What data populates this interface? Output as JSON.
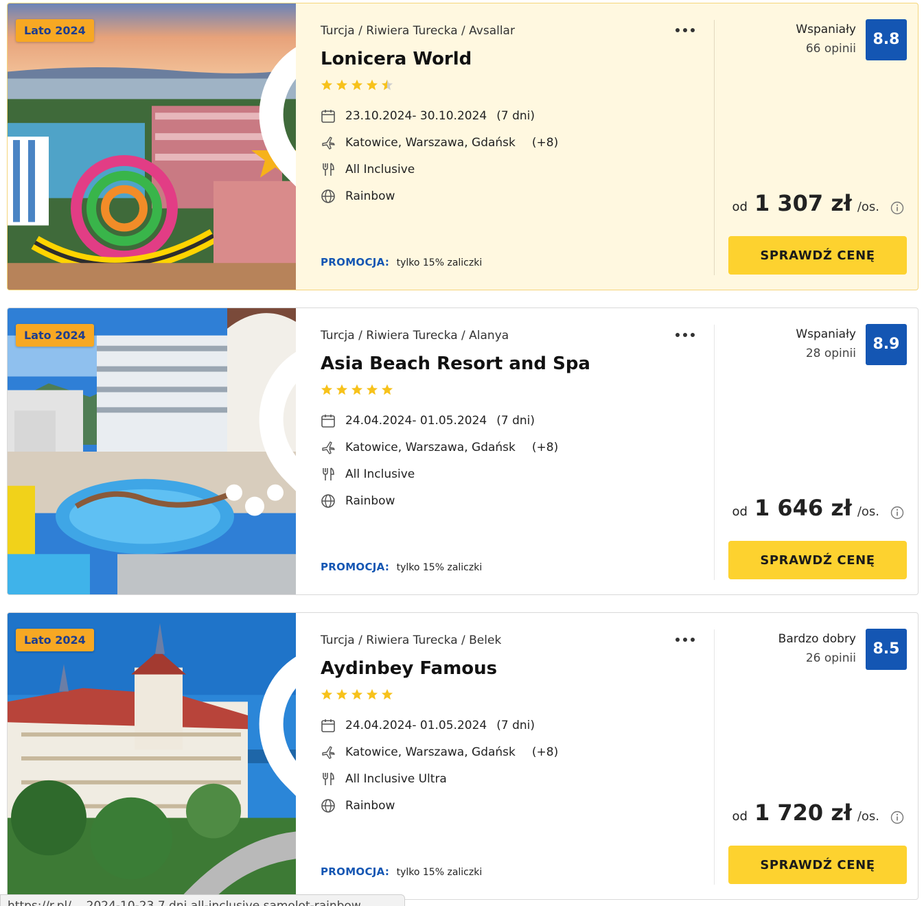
{
  "colors": {
    "badge_bg": "#f7a823",
    "badge_text": "#1d3d8f",
    "score_bg": "#1456b3",
    "promo_label": "#1456b3",
    "button_bg": "#fdd22f",
    "highlight_bg": "#fff8e0",
    "star": "#f7c21b"
  },
  "icons": {
    "favorite": "heart-outline-icon",
    "more": "more-dots-icon",
    "date": "calendar-icon",
    "departure": "plane-icon",
    "board": "cutlery-icon",
    "operator": "globe-icon",
    "price_info": "info-circle-icon",
    "rating_star": "star-icon"
  },
  "offers": [
    {
      "badge": "Lato 2024",
      "breadcrumb": "Turcja / Riwiera Turecka / Avsallar",
      "name": "Lonicera World",
      "stars": 4.5,
      "dates": "23.10.2024- 30.10.2024",
      "duration": "(7 dni)",
      "departure": "Katowice, Warszawa, Gdańsk",
      "departure_more": "(+8)",
      "board": "All Inclusive",
      "operator": "Rainbow",
      "promo_label": "PROMOCJA:",
      "promo_text": "tylko 15% zaliczki",
      "rating_label": "Wspaniały",
      "reviews": "66 opinii",
      "score": "8.8",
      "price_prefix": "od",
      "price": "1 307 zł",
      "price_unit": "/os.",
      "cta": "SPRAWDŹ CENĘ"
    },
    {
      "badge": "Lato 2024",
      "breadcrumb": "Turcja / Riwiera Turecka / Alanya",
      "name": "Asia Beach Resort and Spa",
      "stars": 5,
      "dates": "24.04.2024- 01.05.2024",
      "duration": "(7 dni)",
      "departure": "Katowice, Warszawa, Gdańsk",
      "departure_more": "(+8)",
      "board": "All Inclusive",
      "operator": "Rainbow",
      "promo_label": "PROMOCJA:",
      "promo_text": "tylko 15% zaliczki",
      "rating_label": "Wspaniały",
      "reviews": "28 opinii",
      "score": "8.9",
      "price_prefix": "od",
      "price": "1 646 zł",
      "price_unit": "/os.",
      "cta": "SPRAWDŹ CENĘ"
    },
    {
      "badge": "Lato 2024",
      "breadcrumb": "Turcja / Riwiera Turecka / Belek",
      "name": "Aydinbey Famous",
      "stars": 5,
      "dates": "24.04.2024- 01.05.2024",
      "duration": "(7 dni)",
      "departure": "Katowice, Warszawa, Gdańsk",
      "departure_more": "(+8)",
      "board": "All Inclusive Ultra",
      "operator": "Rainbow",
      "promo_label": "PROMOCJA:",
      "promo_text": "tylko 15% zaliczki",
      "rating_label": "Bardzo dobry",
      "reviews": "26 opinii",
      "score": "8.5",
      "price_prefix": "od",
      "price": "1 720 zł",
      "price_unit": "/os.",
      "cta": "SPRAWDŹ CENĘ"
    }
  ],
  "status_bar": "https://r.pl/... 2024-10-23 7 dni all-inclusive samolot-rainbow"
}
